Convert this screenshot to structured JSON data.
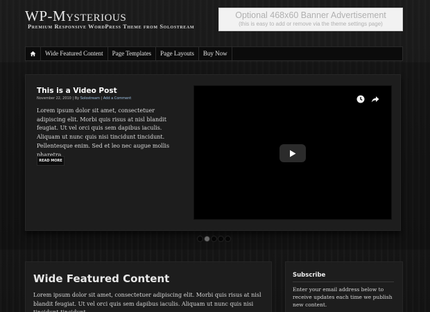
{
  "site": {
    "title": "WP-Mysterious",
    "tagline": "Premium Responsive WordPress Theme from Solostream"
  },
  "banner": {
    "title": "Optional 468x60 Banner Advertisement",
    "subtitle": "(this is easy to add or remove via the theme settings page)"
  },
  "nav": {
    "home_icon": "home-icon",
    "items": [
      {
        "label": "Wide Featured Content"
      },
      {
        "label": "Page Templates"
      },
      {
        "label": "Page Layouts"
      },
      {
        "label": "Buy Now"
      }
    ]
  },
  "featured": {
    "title": "This is a Video Post",
    "date": "November 22, 2010",
    "by_prefix": "| By",
    "author": "Solostream",
    "separator": "|",
    "comment_link": "Add a Comment",
    "body": "Lorem ipsum dolor sit amet, consectetuer adipiscing elit. Morbi quis risus at nisl blandit feugiat. Ut vel orci quis sem dapibus iaculis. Aliquam ut nunc quis nisi tincidunt tincidunt. Pellentesque enim. Sed et leo nec augue mollis pharetra.",
    "read_more": "READ MORE",
    "video": {
      "watch_later_icon": "clock-icon",
      "share_icon": "share-icon",
      "play_icon": "play-icon"
    }
  },
  "slider": {
    "slide_count": 5,
    "active_index": 1
  },
  "wide_content": {
    "title": "Wide Featured Content",
    "body": "Lorem ipsum dolor sit amet, consectetuer adipiscing elit. Morbi quis risus at nisl blandit feugiat. Ut vel orci quis sem dapibus iaculis. Aliquam ut nunc quis nisi tincidunt tincidunt."
  },
  "sidebar": {
    "subscribe_title": "Subscribe",
    "subscribe_text": "Enter your email address below to receive updates each time we publish new content."
  },
  "colors": {
    "background": "#161616",
    "panel": "#1d1d1d",
    "link": "#9fc4e6",
    "banner_bg": "#f2f2f2"
  }
}
